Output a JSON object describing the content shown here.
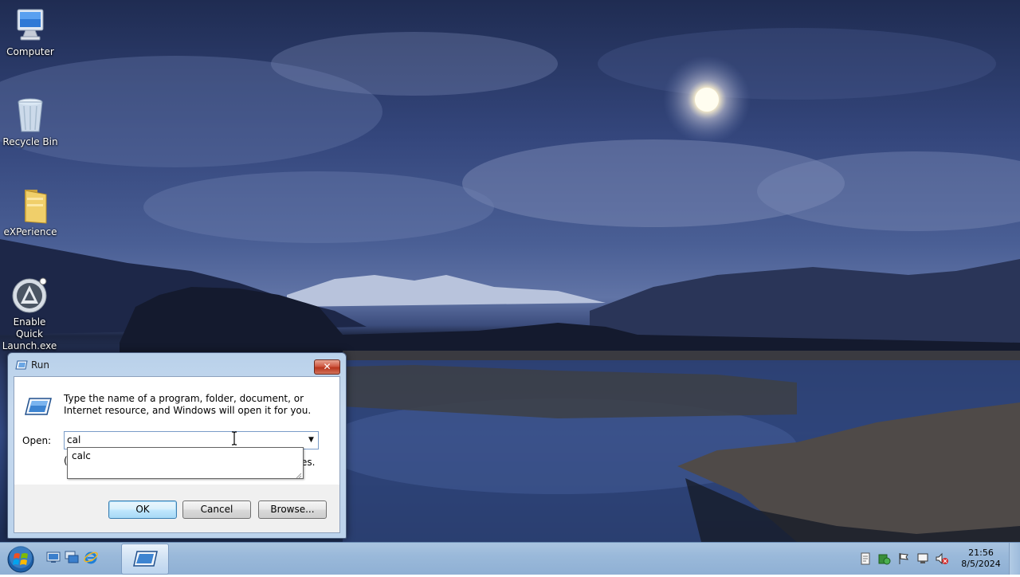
{
  "desktop": {
    "icons": [
      {
        "label": "Computer",
        "icon": "computer-icon"
      },
      {
        "label": "Recycle Bin",
        "icon": "recycle-bin-icon"
      },
      {
        "label": "eXPerience",
        "icon": "folder-icon"
      },
      {
        "label": "Enable Quick Launch.exe",
        "icon": "app-exe-icon"
      }
    ]
  },
  "run_dialog": {
    "title": "Run",
    "close_glyph": "✕",
    "description": "Type the name of a program, folder, document, or Internet resource, and Windows will open it for you.",
    "open_label": "Open:",
    "open_value": "cal",
    "autocomplete": [
      "calc"
    ],
    "partial_hidden_text": "es.",
    "partial_hidden_marker": "(",
    "ok_label": "OK",
    "cancel_label": "Cancel",
    "browse_label": "Browse..."
  },
  "taskbar": {
    "quick_launch": [
      "show-desktop-icon",
      "switch-windows-icon",
      "internet-explorer-icon"
    ],
    "tray": [
      "action-center-icon",
      "security-icon",
      "flag-icon",
      "network-icon",
      "volume-muted-icon"
    ],
    "clock_time": "21:56",
    "clock_date": "8/5/2024"
  },
  "colors": {
    "taskbar": "#9ab9da",
    "window_frame": "#bcd3ec",
    "close_button": "#c9432c",
    "default_button_border": "#3c7fb1"
  }
}
